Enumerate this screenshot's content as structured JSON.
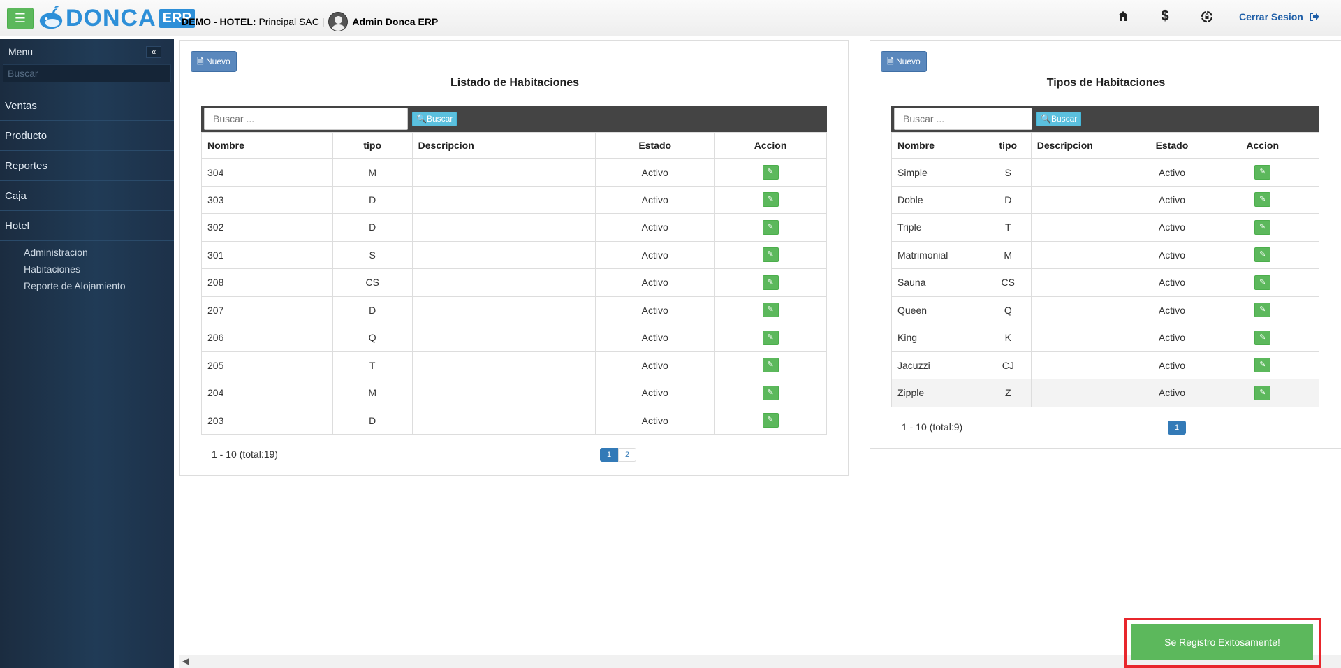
{
  "header": {
    "brand": "DONCA",
    "brand_suffix": "ERP",
    "company_label": "DEMO - HOTEL:",
    "company_name": "Principal SAC |",
    "user_name": "Admin Donca ERP",
    "logout_label": "Cerrar Sesion",
    "icons": [
      "menu-icon",
      "home-icon",
      "dollar-icon",
      "settings-lock-icon",
      "sign-out-icon"
    ]
  },
  "sidebar": {
    "title": "Menu",
    "search_placeholder": "Buscar",
    "items": [
      {
        "label": "Ventas"
      },
      {
        "label": "Producto"
      },
      {
        "label": "Reportes"
      },
      {
        "label": "Caja"
      },
      {
        "label": "Hotel"
      }
    ],
    "hotel_subitems": [
      {
        "label": "Administracion"
      },
      {
        "label": "Habitaciones"
      },
      {
        "label": "Reporte de Alojamiento"
      }
    ]
  },
  "rooms": {
    "new_label": "Nuevo",
    "title": "Listado de Habitaciones",
    "search_placeholder": "Buscar ...",
    "search_label": "Buscar",
    "columns": [
      "Nombre",
      "tipo",
      "Descripcion",
      "Estado",
      "Accion"
    ],
    "rows": [
      {
        "nombre": "304",
        "tipo": "M",
        "descripcion": "",
        "estado": "Activo"
      },
      {
        "nombre": "303",
        "tipo": "D",
        "descripcion": "",
        "estado": "Activo"
      },
      {
        "nombre": "302",
        "tipo": "D",
        "descripcion": "",
        "estado": "Activo"
      },
      {
        "nombre": "301",
        "tipo": "S",
        "descripcion": "",
        "estado": "Activo"
      },
      {
        "nombre": "208",
        "tipo": "CS",
        "descripcion": "",
        "estado": "Activo"
      },
      {
        "nombre": "207",
        "tipo": "D",
        "descripcion": "",
        "estado": "Activo"
      },
      {
        "nombre": "206",
        "tipo": "Q",
        "descripcion": "",
        "estado": "Activo"
      },
      {
        "nombre": "205",
        "tipo": "T",
        "descripcion": "",
        "estado": "Activo"
      },
      {
        "nombre": "204",
        "tipo": "M",
        "descripcion": "",
        "estado": "Activo"
      },
      {
        "nombre": "203",
        "tipo": "D",
        "descripcion": "",
        "estado": "Activo"
      }
    ],
    "page_info": "1 - 10 (total:19)",
    "pages": [
      "1",
      "2"
    ]
  },
  "types": {
    "new_label": "Nuevo",
    "title": "Tipos de Habitaciones",
    "search_placeholder": "Buscar ...",
    "search_label": "Buscar",
    "columns": [
      "Nombre",
      "tipo",
      "Descripcion",
      "Estado",
      "Accion"
    ],
    "rows": [
      {
        "nombre": "Simple",
        "tipo": "S",
        "descripcion": "",
        "estado": "Activo"
      },
      {
        "nombre": "Doble",
        "tipo": "D",
        "descripcion": "",
        "estado": "Activo"
      },
      {
        "nombre": "Triple",
        "tipo": "T",
        "descripcion": "",
        "estado": "Activo"
      },
      {
        "nombre": "Matrimonial",
        "tipo": "M",
        "descripcion": "",
        "estado": "Activo"
      },
      {
        "nombre": "Sauna",
        "tipo": "CS",
        "descripcion": "",
        "estado": "Activo"
      },
      {
        "nombre": "Queen",
        "tipo": "Q",
        "descripcion": "",
        "estado": "Activo"
      },
      {
        "nombre": "King",
        "tipo": "K",
        "descripcion": "",
        "estado": "Activo"
      },
      {
        "nombre": "Jacuzzi",
        "tipo": "CJ",
        "descripcion": "",
        "estado": "Activo"
      },
      {
        "nombre": "Zipple",
        "tipo": "Z",
        "descripcion": "",
        "estado": "Activo"
      }
    ],
    "page_info": "1 - 10 (total:9)",
    "pages": [
      "1"
    ]
  },
  "toast": {
    "message": "Se Registro Exitosamente!",
    "color": "#5cb85c",
    "highlight_color": "#e8262c"
  }
}
